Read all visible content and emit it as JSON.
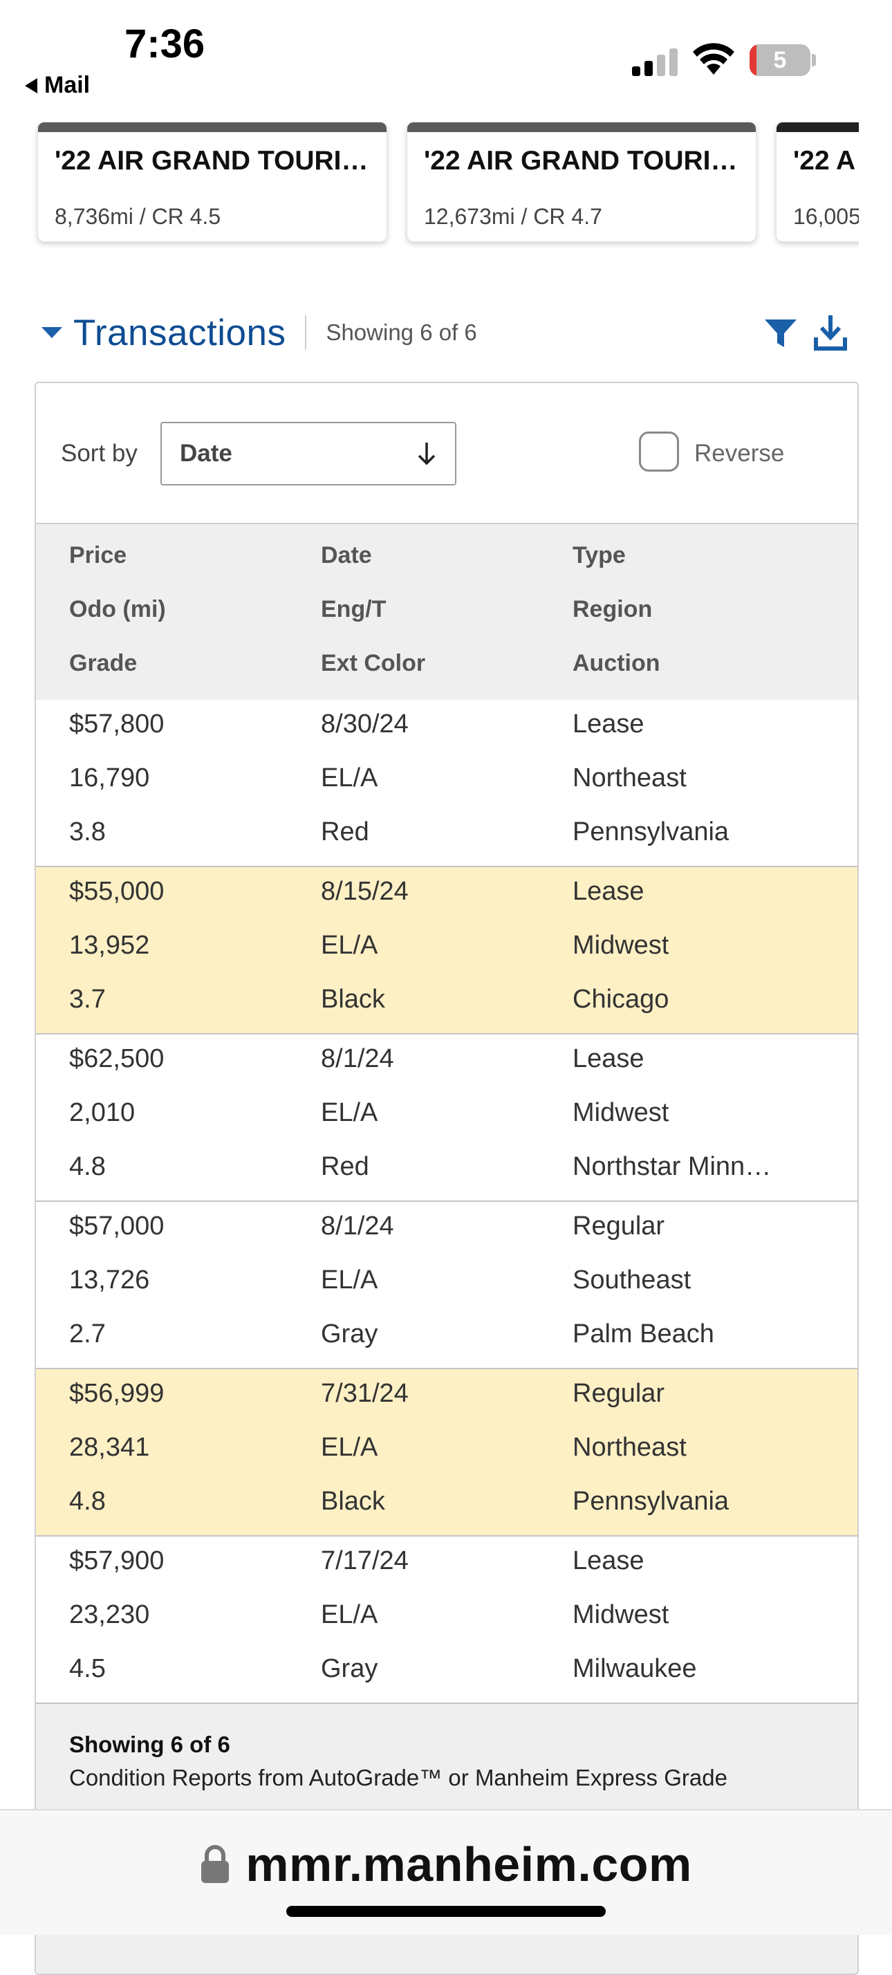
{
  "status_bar": {
    "time": "7:36",
    "back_label": "Mail",
    "battery": "5"
  },
  "cards": [
    {
      "title": "'22 AIR GRAND TOURI…",
      "meta": "8,736mi / CR 4.5"
    },
    {
      "title": "'22 AIR GRAND TOURI…",
      "meta": "12,673mi / CR 4.7"
    },
    {
      "title": "'22 A",
      "meta": "16,005"
    }
  ],
  "transactions": {
    "title": "Transactions",
    "showing": "Showing 6 of 6",
    "sort_label": "Sort by",
    "sort_value": "Date",
    "reverse_label": "Reverse",
    "headers": {
      "col1": [
        "Price",
        "Odo (mi)",
        "Grade"
      ],
      "col2": [
        "Date",
        "Eng/T",
        "Ext Color"
      ],
      "col3": [
        "Type",
        "Region",
        "Auction"
      ]
    },
    "rows": [
      {
        "price": "$57,800",
        "odo": "16,790",
        "grade": "3.8",
        "date": "8/30/24",
        "eng": "EL/A",
        "color": "Red",
        "type": "Lease",
        "region": "Northeast",
        "auction": "Pennsylvania",
        "highlight": false
      },
      {
        "price": "$55,000",
        "odo": "13,952",
        "grade": "3.7",
        "date": "8/15/24",
        "eng": "EL/A",
        "color": "Black",
        "type": "Lease",
        "region": "Midwest",
        "auction": "Chicago",
        "highlight": true
      },
      {
        "price": "$62,500",
        "odo": "2,010",
        "grade": "4.8",
        "date": "8/1/24",
        "eng": "EL/A",
        "color": "Red",
        "type": "Lease",
        "region": "Midwest",
        "auction": "Northstar Minn…",
        "highlight": false
      },
      {
        "price": "$57,000",
        "odo": "13,726",
        "grade": "2.7",
        "date": "8/1/24",
        "eng": "EL/A",
        "color": "Gray",
        "type": "Regular",
        "region": "Southeast",
        "auction": "Palm Beach",
        "highlight": false
      },
      {
        "price": "$56,999",
        "odo": "28,341",
        "grade": "4.8",
        "date": "7/31/24",
        "eng": "EL/A",
        "color": "Black",
        "type": "Regular",
        "region": "Northeast",
        "auction": "Pennsylvania",
        "highlight": true
      },
      {
        "price": "$57,900",
        "odo": "23,230",
        "grade": "4.5",
        "date": "7/17/24",
        "eng": "EL/A",
        "color": "Gray",
        "type": "Lease",
        "region": "Midwest",
        "auction": "Milwaukee",
        "highlight": false
      }
    ],
    "footer_showing": "Showing 6 of 6",
    "footer_note": "Condition Reports from AutoGrade™ or Manheim Express Grade"
  },
  "browser": {
    "url": "mmr.manheim.com"
  },
  "colors": {
    "accent": "#0e4c92",
    "highlight_row": "#fdf0c5",
    "header_bg": "#efefef"
  }
}
